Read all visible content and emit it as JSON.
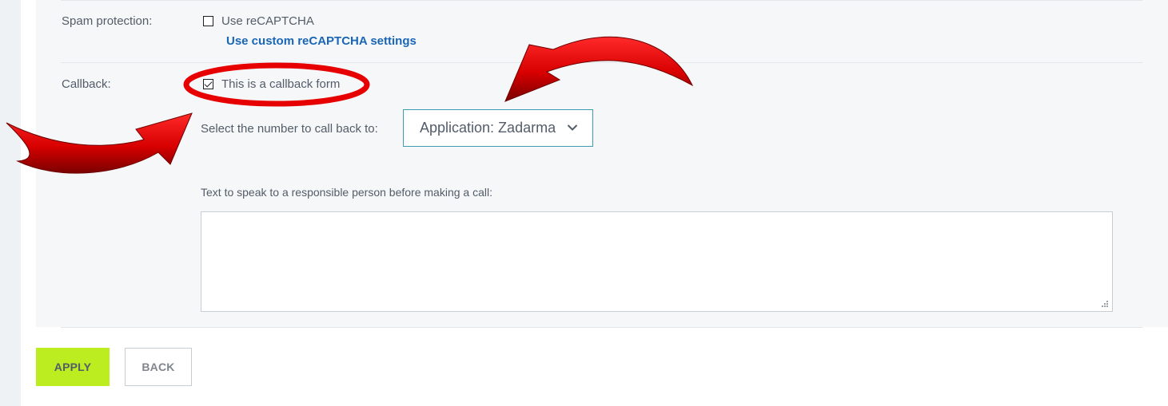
{
  "spam": {
    "label": "Spam protection:",
    "recaptcha_label": "Use reCAPTCHA",
    "recaptcha_checked": false,
    "custom_link": "Use custom reCAPTCHA settings"
  },
  "callback": {
    "label": "Callback:",
    "checkbox_label": "This is a callback form",
    "checkbox_checked": true,
    "select_label": "Select the number to call back to:",
    "select_value": "Application: Zadarma",
    "text_label": "Text to speak to a responsible person before making a call:",
    "text_value": ""
  },
  "buttons": {
    "apply": "APPLY",
    "back": "BACK"
  },
  "annotations": {
    "color": "#e00000",
    "shapes": [
      "ellipse-highlight",
      "arrow-left",
      "arrow-right"
    ]
  }
}
